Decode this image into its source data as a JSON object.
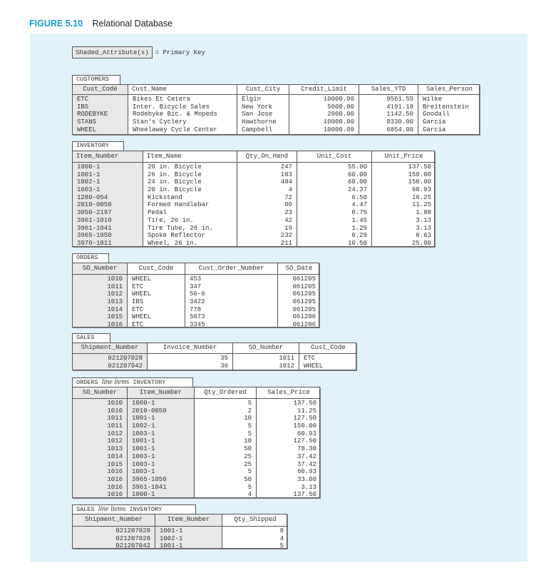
{
  "figure": {
    "number": "FIGURE 5.10",
    "title": "Relational Database"
  },
  "legend": {
    "key_label": "Shaded_Attribute(s)",
    "equals_text": "= Primary Key"
  },
  "tables": {
    "customers": {
      "caption": "CUSTOMERS",
      "columns": [
        "Cust_Code",
        "Cust_Name",
        "Cust_City",
        "Credit_Limit",
        "Sales_YTD",
        "Sales_Person"
      ],
      "primary_key": [
        "Cust_Code"
      ],
      "rows": [
        [
          "ETC",
          "Bikes Et Cetera",
          "Elgin",
          "10000.00",
          "9561.55",
          "Wilke"
        ],
        [
          "IBS",
          "Inter. Bicycle Sales",
          "New York",
          "5000.00",
          "4191.18",
          "Breitenstein"
        ],
        [
          "RODEBYKE",
          "Rodebyke Bic. & Mopeds",
          "San Jose",
          "2000.00",
          "1142.50",
          "Goodall"
        ],
        [
          "STANS",
          "Stan's Cyclery",
          "Hawthorne",
          "10000.00",
          "8330.00",
          "Garcia"
        ],
        [
          "WHEEL",
          "Wheelaway Cycle Center",
          "Campbell",
          "10000.00",
          "6854.00",
          "Garcia"
        ]
      ]
    },
    "inventory": {
      "caption": "INVENTORY",
      "columns": [
        "Item_Number",
        "Item_Name",
        "Qty_On_Hand",
        "Unit_Cost",
        "Unit_Price"
      ],
      "primary_key": [
        "Item_Number"
      ],
      "rows": [
        [
          "1000-1",
          "20 in. Bicycle",
          "247",
          "55.00",
          "137.50"
        ],
        [
          "1001-1",
          "26 in. Bicycle",
          "103",
          "60.00",
          "150.00"
        ],
        [
          "1002-1",
          "24 in. Bicycle",
          "484",
          "60.00",
          "150.00"
        ],
        [
          "1003-1",
          "20 in. Bicycle",
          "4",
          "24.37",
          "60.93"
        ],
        [
          "1280-054",
          "Kickstand",
          "72",
          "6.50",
          "16.25"
        ],
        [
          "2010-0050",
          "Formed Handlebar",
          "90",
          "4.47",
          "11.25"
        ],
        [
          "3050-2197",
          "Pedal",
          "23",
          "0.75",
          "1.88"
        ],
        [
          "3961-1010",
          "Tire, 26 in.",
          "42",
          "1.45",
          "3.13"
        ],
        [
          "3961-1041",
          "Tire Tube, 26 in.",
          "19",
          "1.25",
          "3.13"
        ],
        [
          "3965-1050",
          "Spoke Reflector",
          "232",
          "0.29",
          "0.63"
        ],
        [
          "3970-1011",
          "Wheel, 26 in.",
          "211",
          "10.50",
          "25.00"
        ]
      ]
    },
    "orders": {
      "caption": "ORDERS",
      "columns": [
        "SO_Number",
        "Cust_Code",
        "Cust_Order_Number",
        "SO_Date"
      ],
      "primary_key": [
        "SO_Number"
      ],
      "rows": [
        [
          "1010",
          "WHEEL",
          "453",
          "061205"
        ],
        [
          "1011",
          "ETC",
          "347",
          "061205"
        ],
        [
          "1012",
          "WHEEL",
          "56-6",
          "061205"
        ],
        [
          "1013",
          "IBS",
          "3422",
          "061205"
        ],
        [
          "1014",
          "ETC",
          "778",
          "061205"
        ],
        [
          "1015",
          "WHEEL",
          "5673",
          "061206"
        ],
        [
          "1016",
          "ETC",
          "3345",
          "061206"
        ]
      ]
    },
    "sales": {
      "caption": "SALES",
      "columns": [
        "Shipment_Number",
        "Invoice_Number",
        "SO_Number",
        "Cust_Code"
      ],
      "primary_key": [
        "Shipment_Number"
      ],
      "rows": [
        [
          "021207028",
          "35",
          "1011",
          "ETC"
        ],
        [
          "021207042",
          "36",
          "1012",
          "WHEEL"
        ]
      ]
    },
    "orders_line_items": {
      "caption_left": "ORDERS",
      "caption_mid": "line items",
      "caption_right": "INVENTORY",
      "columns": [
        "SO_Number",
        "Item_Number",
        "Qty_Ordered",
        "Sales_Price"
      ],
      "primary_key": [
        "SO_Number",
        "Item_Number"
      ],
      "rows": [
        [
          "1010",
          "1000-1",
          "5",
          "137.50"
        ],
        [
          "1010",
          "2010-0050",
          "2",
          "11.25"
        ],
        [
          "1011",
          "1001-1",
          "10",
          "127.50"
        ],
        [
          "1011",
          "1002-1",
          "5",
          "150.00"
        ],
        [
          "1012",
          "1003-1",
          "5",
          "60.93"
        ],
        [
          "1012",
          "1001-1",
          "10",
          "127.50"
        ],
        [
          "1013",
          "1001-1",
          "50",
          "78.30"
        ],
        [
          "1014",
          "1003-1",
          "25",
          "37.42"
        ],
        [
          "1015",
          "1003-1",
          "25",
          "37.42"
        ],
        [
          "1016",
          "1003-1",
          "5",
          "60.93"
        ],
        [
          "1016",
          "3965-1050",
          "50",
          "33.00"
        ],
        [
          "1016",
          "3961-1041",
          "5",
          "3.13"
        ],
        [
          "1016",
          "1000-1",
          "4",
          "137.50"
        ]
      ]
    },
    "sales_line_items": {
      "caption_left": "SALES",
      "caption_mid": "line items",
      "caption_right": "INVENTORY",
      "columns": [
        "Shipment_Number",
        "Item_Number",
        "Qty_Shipped"
      ],
      "primary_key": [
        "Shipment_Number",
        "Item_Number"
      ],
      "rows": [
        [
          "021207028",
          "1001-1",
          "8"
        ],
        [
          "021207028",
          "1002-1",
          "4"
        ],
        [
          "021207042",
          "1001-1",
          "5"
        ]
      ]
    }
  }
}
